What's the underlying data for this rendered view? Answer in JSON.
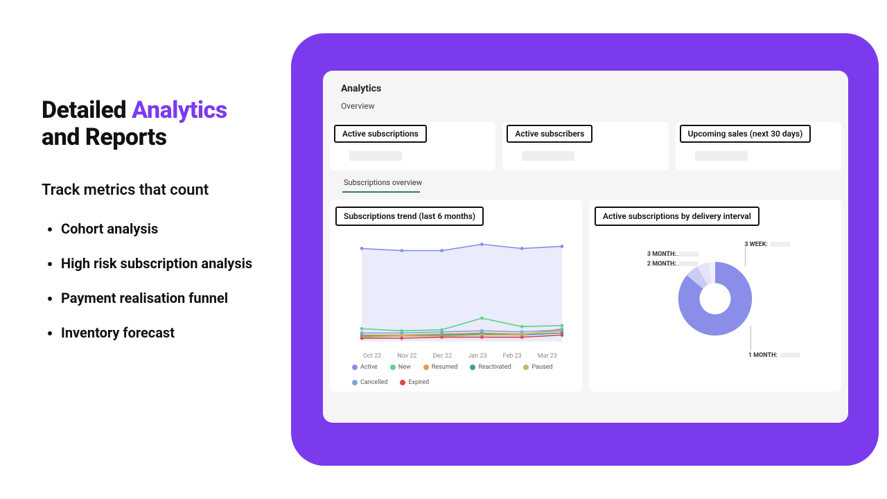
{
  "colors": {
    "accent": "#7C3AED",
    "active": "#8A8EE8",
    "new": "#5FD28A",
    "resumed": "#E89A4B",
    "reactivated": "#3C9D9B",
    "paused": "#C8B46A",
    "cancelled": "#7BA9D9",
    "expired": "#D94B4B",
    "tab_underline": "#2E7D63"
  },
  "marketing": {
    "headline_1": "Detailed ",
    "headline_accent": "Analytics",
    "headline_2": "and Reports",
    "sub": "Track metrics that count",
    "features": [
      "Cohort analysis",
      "High risk subscription analysis",
      "Payment realisation funnel",
      "Inventory forecast"
    ]
  },
  "panel": {
    "title": "Analytics",
    "subtitle": "Overview",
    "cards": [
      {
        "label": "Active subscriptions"
      },
      {
        "label": "Active subscribers"
      },
      {
        "label": "Upcoming sales (next 30 days)"
      }
    ],
    "tab": "Subscriptions overview",
    "trend_title": "Subscriptions trend (last 6 months)",
    "donut_title": "Active subscriptions by delivery interval"
  },
  "chart_data": [
    {
      "type": "line",
      "title": "Subscriptions trend (last 6 months)",
      "xlabel": "",
      "ylabel": "",
      "categories": [
        "Oct 22",
        "Nov 22",
        "Dec 22",
        "Jan 23",
        "Feb 23",
        "Mar 23"
      ],
      "ylim": [
        0,
        100
      ],
      "series": [
        {
          "name": "Active",
          "color": "#8A8EE8",
          "values": [
            88,
            86,
            86,
            92,
            88,
            90
          ]
        },
        {
          "name": "New",
          "color": "#5FD28A",
          "values": [
            12,
            10,
            11,
            22,
            14,
            15
          ]
        },
        {
          "name": "Resumed",
          "color": "#E89A4B",
          "values": [
            6,
            6,
            7,
            8,
            7,
            10
          ]
        },
        {
          "name": "Reactivated",
          "color": "#3C9D9B",
          "values": [
            5,
            5,
            6,
            7,
            6,
            8
          ]
        },
        {
          "name": "Paused",
          "color": "#C8B46A",
          "values": [
            4,
            5,
            5,
            6,
            6,
            12
          ]
        },
        {
          "name": "Cancelled",
          "color": "#7BA9D9",
          "values": [
            8,
            8,
            9,
            10,
            9,
            11
          ]
        },
        {
          "name": "Expired",
          "color": "#D94B4B",
          "values": [
            3,
            3,
            4,
            4,
            4,
            6
          ]
        }
      ]
    },
    {
      "type": "pie",
      "title": "Active subscriptions by delivery interval",
      "series": [
        {
          "name": "1 MONTH:",
          "value": 86,
          "color": "#8A8EE8"
        },
        {
          "name": "2 MONTH:",
          "value": 6,
          "color": "#C9CCF3"
        },
        {
          "name": "3 MONTH:",
          "value": 5,
          "color": "#E3E4F8"
        },
        {
          "name": "3 WEEK:",
          "value": 3,
          "color": "#EFF0FB"
        }
      ]
    }
  ]
}
